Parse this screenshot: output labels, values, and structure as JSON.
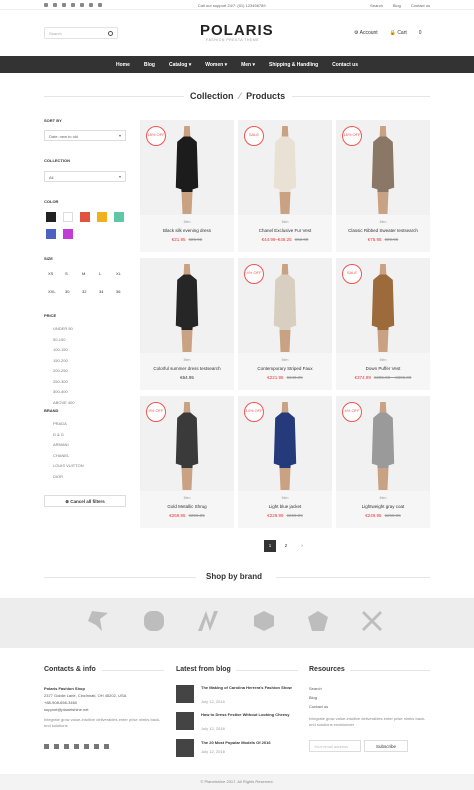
{
  "topbar": {
    "support": "Call our support 24/7: (01) 123456789",
    "links": [
      "Search",
      "Blog",
      "Contact us"
    ]
  },
  "header": {
    "search_placeholder": "Search",
    "logo": "POLARIS",
    "tagline": "FASHION PRESTA THEME",
    "account": "Account",
    "cart": "Cart",
    "cart_count": "0"
  },
  "nav": [
    "Home",
    "Blog",
    "Catalog ▾",
    "Women ▾",
    "Men ▾",
    "Shipping & Handling",
    "Contact us"
  ],
  "page_title": {
    "part1": "Collection",
    "sep": "⁄",
    "part2": "Products"
  },
  "sidebar": {
    "sort_label": "SORT BY",
    "sort_value": "Date: new to old",
    "collection_label": "COLLECTION",
    "collection_value": "All",
    "color_label": "COLOR",
    "colors": [
      "#222222",
      "#ffffff",
      "#e0543f",
      "#f0b21c",
      "#5fc7a5",
      "#4d62c0",
      "#c23cd6"
    ],
    "size_label": "SIZE",
    "sizes": [
      "XS",
      "S",
      "M",
      "L",
      "XL",
      "XXL",
      "30",
      "32",
      "34",
      "36"
    ],
    "price_label": "PRICE",
    "prices": [
      "UNDER 50",
      "50-100",
      "100-150",
      "150-200",
      "200-250",
      "250-300",
      "300-400",
      "ABOVE 400"
    ],
    "brand_label": "BRAND",
    "brands": [
      "PRADA",
      "D & G",
      "ARMANI",
      "CHANEL",
      "LOUIS VUITTON",
      "DIOR"
    ],
    "cancel": "Cancel all filters"
  },
  "products": [
    {
      "badge": "18% OFF",
      "cat": "Men",
      "name": "Black silk evening dress",
      "price": "€21.95",
      "old": "€26.95",
      "color": "#1c1c1c"
    },
    {
      "badge": "SALE",
      "cat": "Men",
      "name": "Chanel Exclusive Fur Vest",
      "price": "€44.99–€46.25",
      "old": "€62.00",
      "color": "#e9e2d4"
    },
    {
      "badge": "18% OFF",
      "cat": "Men",
      "name": "Classic Ribbed Sweater testsearch",
      "price": "€75.95",
      "old": "€89.95",
      "color": "#8a7766"
    },
    {
      "badge": "",
      "cat": "Men",
      "name": "Colorful summer dress testsearch",
      "price": "€64.95",
      "old": "",
      "color": "#262626"
    },
    {
      "badge": "4% OFF",
      "cat": "Men",
      "name": "Contemporary Striped Faux",
      "price": "€221.95",
      "old": "€246.95",
      "color": "#d9cfc0"
    },
    {
      "badge": "SALE",
      "cat": "Men",
      "name": "Down Puffer Vest",
      "price": "€374.99",
      "old": "€385.00 – €395.00",
      "color": "#9c6a3b"
    },
    {
      "badge": "9% OFF",
      "cat": "Men",
      "name": "Gold Metallic Shrug",
      "price": "€269.95",
      "old": "€296.95",
      "color": "#3a3a3a"
    },
    {
      "badge": "14% OFF",
      "cat": "Men",
      "name": "Light blue jacket",
      "price": "€229.99",
      "old": "€269.99",
      "color": "#243a7a"
    },
    {
      "badge": "4% OFF",
      "cat": "Men",
      "name": "Lightweight gray coat",
      "price": "€249.95",
      "old": "€260.95",
      "color": "#9a9a9a"
    }
  ],
  "pagination": [
    "1",
    "2",
    "›"
  ],
  "shop_by_brand": "Shop by brand",
  "footer": {
    "contacts_title": "Contacts & info",
    "shop_name": "Polaris Fashion Shop",
    "address": "2377 Goldie Lane, Cincinnati, OH 45202, USA",
    "phone": "+88-908-656-3460",
    "email": "support@planetshine.net",
    "about": "Integrate grow value-intuitive deliverables enter prise nimbs back-end solutions",
    "blog_title": "Latest from blog",
    "posts": [
      {
        "title": "The Making of Carolina Herrera's Fashion Show",
        "date": "July 12, 2016"
      },
      {
        "title": "How to Dress Festive Without Looking Cheesy",
        "date": "July 12, 2016"
      },
      {
        "title": "The 20 Most Popular Models Of 2016",
        "date": "July 12, 2016"
      }
    ],
    "resources_title": "Resources",
    "resources": [
      "Search",
      "Blog",
      "Contact us"
    ],
    "res_about": "Integrate grow value-intuitive deliverables enter prise nimbs back-end solutions envisioneer",
    "email_placeholder": "Your email address",
    "subscribe": "Subscribe",
    "copyright": "© Planetshine 2017. All Rights Reserved."
  }
}
